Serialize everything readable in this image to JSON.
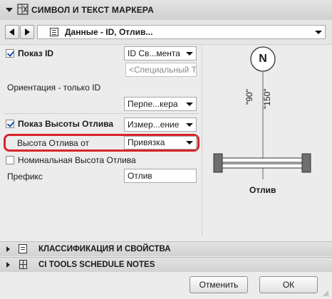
{
  "header": {
    "title": "СИМВОЛ И ТЕКСТ МАРКЕРА",
    "icon": "marker-panel-icon"
  },
  "nav": {
    "dropdown_value": "Данные - ID, Отлив..."
  },
  "settings": {
    "show_id": {
      "label": "Показ ID",
      "checked": true,
      "value": "ID Св...мента",
      "custom_placeholder": "<Специальный Т"
    },
    "orientation": {
      "label": "Ориентация - только ID",
      "value": "Перпе...кера"
    },
    "show_sill_height": {
      "label": "Показ Высоты Отлива",
      "checked": true,
      "value": "Измер...ение"
    },
    "sill_height_from": {
      "label": "Высота Отлива от",
      "value": "Привязка"
    },
    "nominal_sill_height": {
      "label": "Номинальная Высота Отлива",
      "checked": false
    },
    "prefix": {
      "label": "Префикс",
      "value": "Отлив"
    }
  },
  "preview": {
    "marker_letter": "N",
    "dim1": "\"90\"",
    "dim2": "\"150\"",
    "caption": "Отлив"
  },
  "sections": [
    {
      "title": "КЛАССИФИКАЦИЯ И СВОЙСТВА",
      "icon": "document-icon"
    },
    {
      "title": "CI TOOLS SCHEDULE NOTES",
      "icon": "grid-icon"
    }
  ],
  "buttons": {
    "cancel": "Отменить",
    "ok": "ОК"
  },
  "colors": {
    "highlight": "#d8242a",
    "check": "#1a4fb0"
  }
}
